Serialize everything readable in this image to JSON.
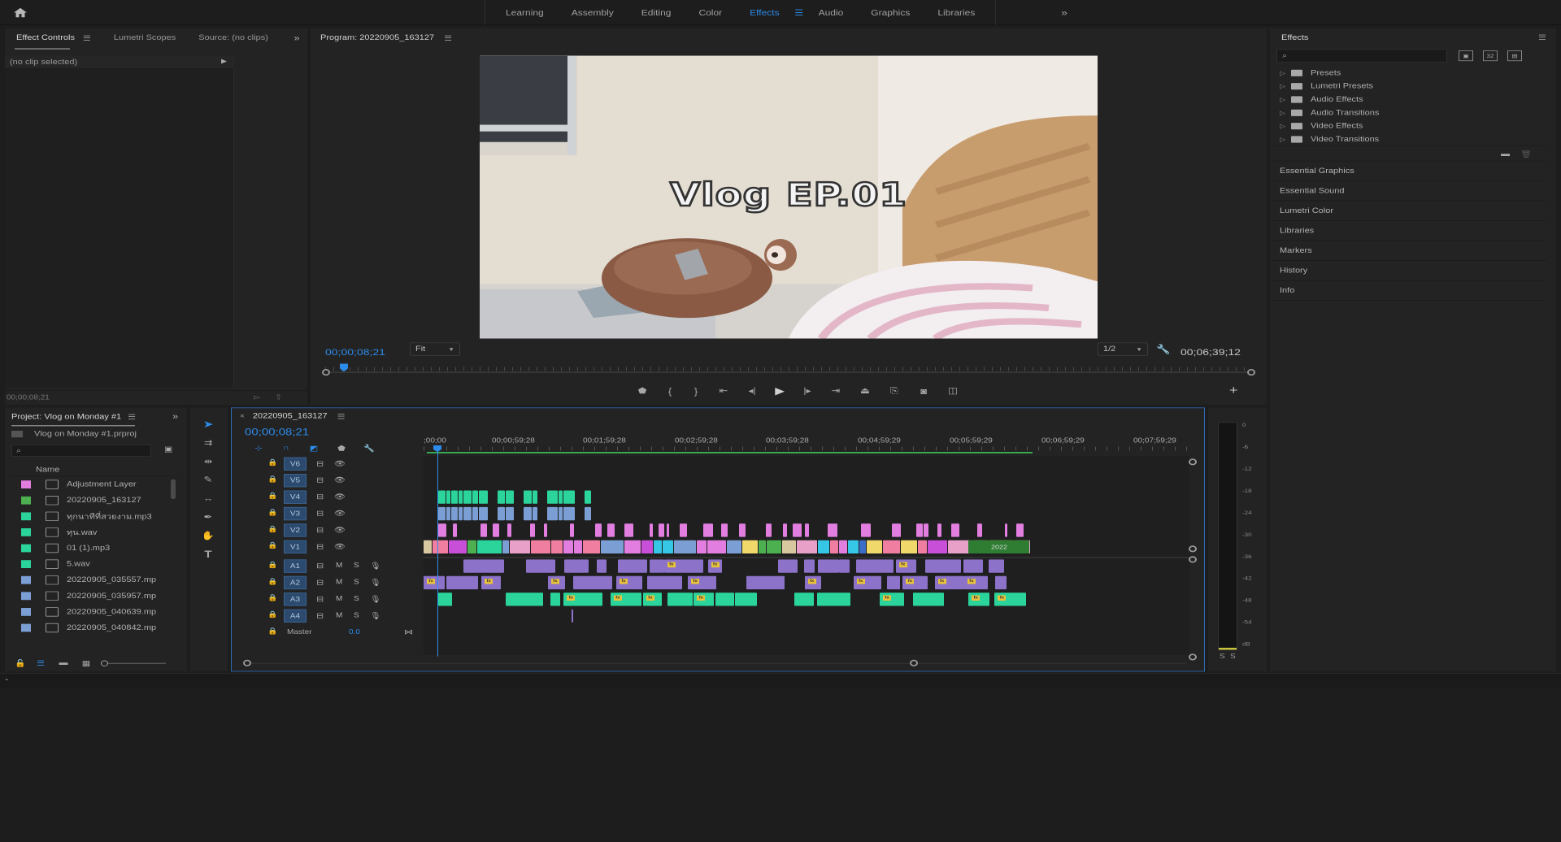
{
  "topbar": {
    "workspaces": [
      {
        "label": "Learning",
        "active": false
      },
      {
        "label": "Assembly",
        "active": false
      },
      {
        "label": "Editing",
        "active": false
      },
      {
        "label": "Color",
        "active": false
      },
      {
        "label": "Effects",
        "active": true
      },
      {
        "label": "Audio",
        "active": false
      },
      {
        "label": "Graphics",
        "active": false
      },
      {
        "label": "Libraries",
        "active": false
      }
    ]
  },
  "source_panel": {
    "tabs": [
      "Effect Controls",
      "Lumetri Scopes",
      "Source: (no clips)"
    ],
    "no_clip": "(no clip selected)",
    "timecode": "00;00;08;21"
  },
  "program": {
    "title": "Program: 20220905_163127",
    "overlay": "Vlog EP.01",
    "timecode": "00;00;08;21",
    "fit": "Fit",
    "quality": "1/2",
    "duration": "00;06;39;12"
  },
  "effects": {
    "title": "Effects",
    "search_placeholder": "",
    "folders": [
      "Presets",
      "Lumetri Presets",
      "Audio Effects",
      "Audio Transitions",
      "Video Effects",
      "Video Transitions"
    ],
    "panels": [
      "Essential Graphics",
      "Essential Sound",
      "Lumetri Color",
      "Libraries",
      "Markers",
      "History",
      "Info"
    ]
  },
  "project": {
    "title": "Project: Vlog on Monday #1",
    "file": "Vlog on Monday #1.prproj",
    "name_header": "Name",
    "items": [
      {
        "name": "Adjustment Layer",
        "color": "#e27ee0"
      },
      {
        "name": "20220905_163127",
        "color": "#4caf50"
      },
      {
        "name": "ทุกนาทีที่สวยงาม.mp3",
        "color": "#2bd49b"
      },
      {
        "name": "ทุน.wav",
        "color": "#2bd49b"
      },
      {
        "name": "01 (1).mp3",
        "color": "#2bd49b"
      },
      {
        "name": "5.wav",
        "color": "#2bd49b"
      },
      {
        "name": "20220905_035557.mp",
        "color": "#7b9fd4"
      },
      {
        "name": "20220905_035957.mp",
        "color": "#7b9fd4"
      },
      {
        "name": "20220905_040639.mp",
        "color": "#7b9fd4"
      },
      {
        "name": "20220905_040842.mp",
        "color": "#7b9fd4"
      }
    ]
  },
  "timeline": {
    "title": "20220905_163127",
    "timecode": "00;00;08;21",
    "ruler": [
      ";00;00",
      "00;00;59;28",
      "00;01;59;28",
      "00;02;59;28",
      "00;03;59;28",
      "00;04;59;29",
      "00;05;59;29",
      "00;06;59;29",
      "00;07;59;29"
    ],
    "video_tracks": [
      "V6",
      "V5",
      "V4",
      "V3",
      "V2",
      "V1"
    ],
    "audio_tracks": [
      "A1",
      "A2",
      "A3",
      "A4"
    ],
    "track_m": "M",
    "track_s": "S",
    "master_label": "Master",
    "master_value": "0.0",
    "clip_label": "2022"
  },
  "meter": {
    "scale": [
      "0",
      "-6",
      "-12",
      "-18",
      "-24",
      "-30",
      "-36",
      "-42",
      "-48",
      "-54",
      "dB"
    ],
    "solo": [
      "S",
      "S"
    ]
  },
  "colors": {
    "accent": "#2d8ceb",
    "video_clip": "#2bd49b",
    "audio_clip": "#9a7ad0",
    "panel": "#232323"
  }
}
